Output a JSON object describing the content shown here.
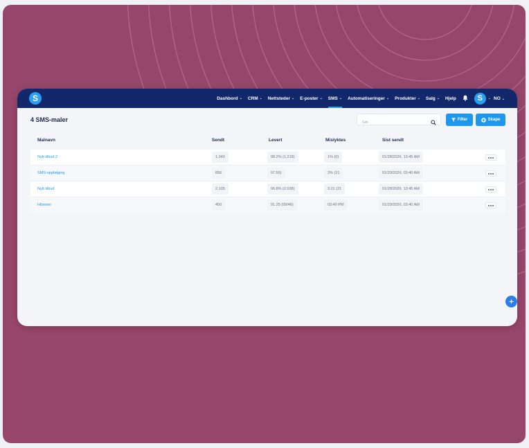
{
  "app": {
    "logo_letter": "S",
    "brand_color": "#13286a",
    "accent_color": "#1f98ec",
    "background_color": "#96466a"
  },
  "nav": {
    "items": [
      {
        "label": "Dashbord",
        "has_dropdown": true,
        "active": false
      },
      {
        "label": "CRM",
        "has_dropdown": true,
        "active": false
      },
      {
        "label": "Nettsteder",
        "has_dropdown": true,
        "active": false
      },
      {
        "label": "E-poster",
        "has_dropdown": true,
        "active": false
      },
      {
        "label": "SMS",
        "has_dropdown": true,
        "active": true
      },
      {
        "label": "Automatiseringer",
        "has_dropdown": true,
        "active": false
      },
      {
        "label": "Produkter",
        "has_dropdown": true,
        "active": false
      },
      {
        "label": "Salg",
        "has_dropdown": true,
        "active": false
      },
      {
        "label": "Hjelp",
        "has_dropdown": false,
        "active": false
      }
    ],
    "notification_icon": "bell-icon",
    "avatar_letter": "S",
    "language": "NO"
  },
  "page": {
    "title": "4 SMS-maler",
    "search_placeholder": "Søk",
    "filter_label": "Filter",
    "create_label": "Skape"
  },
  "table": {
    "columns": [
      "Malnavn",
      "Sendt",
      "Levert",
      "Mislyktes",
      "Sist sendt"
    ],
    "rows": [
      {
        "name": "Nytt tilbud 2",
        "sent": "1,240",
        "delivered": "98.2% (1,218)",
        "failed": "1% (0)",
        "last_sent": "01/28/2026, 13:45 AM"
      },
      {
        "name": "SMS-oppfølging",
        "sent": "856",
        "delivered": "97.55)",
        "failed": "2% (21",
        "last_sent": "01/29/2026, 03:40 AM"
      },
      {
        "name": "Nytt tilbud",
        "sent": "2,105",
        "delivered": "96.8% (2.038)",
        "failed": "3.21 (21",
        "last_sent": "01/28/2026, 13:45 AM"
      },
      {
        "name": "Hilsener",
        "sent": "450",
        "delivered": "91.25 (09/46)",
        "failed": "03:40 PM",
        "last_sent": "01/29/2026, 03:40 AM"
      }
    ]
  }
}
